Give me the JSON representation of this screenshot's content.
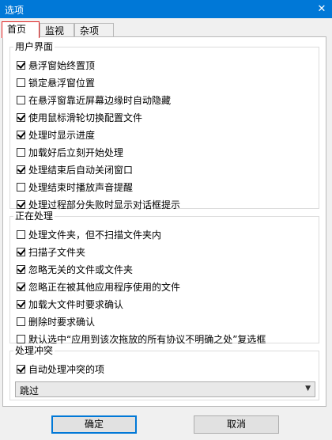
{
  "window": {
    "title": "选项",
    "close_glyph": "✕"
  },
  "tabs": [
    {
      "label": "首页",
      "active": true
    },
    {
      "label": "监视",
      "active": false
    },
    {
      "label": "杂项",
      "active": false
    }
  ],
  "groups": {
    "ui": {
      "legend": "用户界面",
      "items": [
        {
          "label": "悬浮窗始终置顶",
          "checked": true
        },
        {
          "label": "锁定悬浮窗位置",
          "checked": false
        },
        {
          "label": "在悬浮窗靠近屏幕边缘时自动隐藏",
          "checked": false
        },
        {
          "label": "使用鼠标滑轮切换配置文件",
          "checked": true
        },
        {
          "label": "处理时显示进度",
          "checked": true
        },
        {
          "label": "加载好后立刻开始处理",
          "checked": false
        },
        {
          "label": "处理结束后自动关闭窗口",
          "checked": true
        },
        {
          "label": "处理结束时播放声音提醒",
          "checked": false
        },
        {
          "label": "处理过程部分失败时显示对话框提示",
          "checked": true
        }
      ]
    },
    "processing": {
      "legend": "正在处理",
      "items": [
        {
          "label": "处理文件夹，但不扫描文件夹内",
          "checked": false
        },
        {
          "label": "扫描子文件夹",
          "checked": true
        },
        {
          "label": "忽略无关的文件或文件夹",
          "checked": true
        },
        {
          "label": "忽略正在被其他应用程序使用的文件",
          "checked": true
        },
        {
          "label": "加载大文件时要求确认",
          "checked": true
        },
        {
          "label": "删除时要求确认",
          "checked": false
        },
        {
          "label": "默认选中“应用到该次拖放的所有协议不明确之处”复选框",
          "checked": false
        }
      ]
    },
    "conflict": {
      "legend": "处理冲突",
      "items": [
        {
          "label": "自动处理冲突的项",
          "checked": true
        }
      ],
      "select_value": "跳过"
    }
  },
  "buttons": {
    "ok": "确定",
    "cancel": "取消"
  }
}
